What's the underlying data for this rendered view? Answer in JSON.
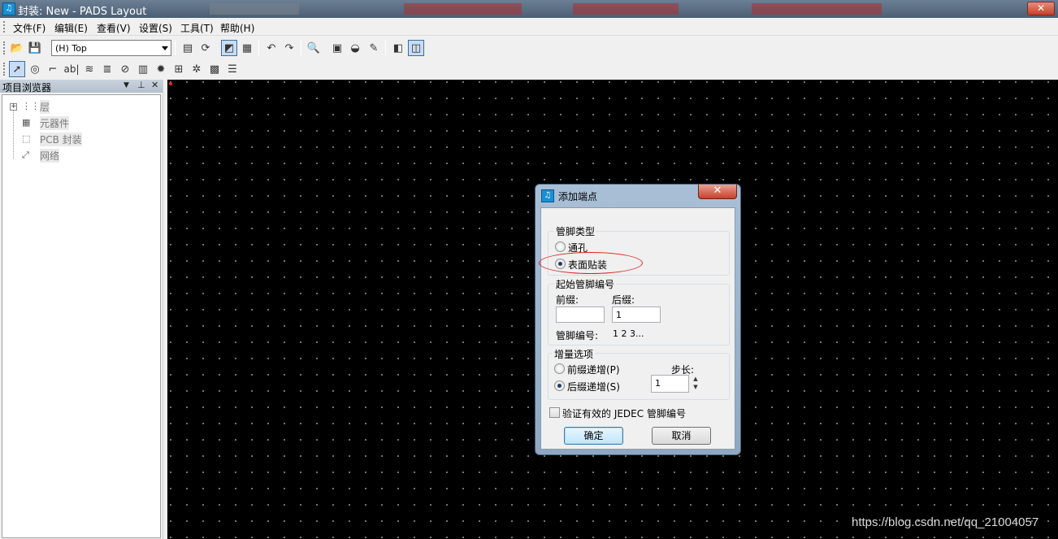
{
  "window": {
    "title": "封装: New - PADS Layout",
    "app_icon": "pads-icon",
    "close_label": "✕"
  },
  "menubar": {
    "items": [
      {
        "label": "文件(F)"
      },
      {
        "label": "编辑(E)"
      },
      {
        "label": "查看(V)"
      },
      {
        "label": "设置(S)"
      },
      {
        "label": "工具(T)"
      },
      {
        "label": "帮助(H)"
      }
    ]
  },
  "toolbar": {
    "layer_select": "(H) Top",
    "text_tool_label": "ab|"
  },
  "browser": {
    "title": "项目浏览器",
    "items": [
      {
        "label": "层",
        "expand": "+"
      },
      {
        "label": "元器件"
      },
      {
        "label": "PCB 封装"
      },
      {
        "label": "网络"
      }
    ]
  },
  "dialog": {
    "title": "添加端点",
    "close_label": "✕",
    "pin_type": {
      "group_label": "管脚类型",
      "options": [
        {
          "label": "通孔",
          "checked": false
        },
        {
          "label": "表面贴装",
          "checked": true
        }
      ]
    },
    "start_pin_number": {
      "group_label": "起始管脚编号",
      "prefix_label": "前缀:",
      "prefix_value": "",
      "suffix_label": "后缀:",
      "suffix_value": "1",
      "pin_number_label": "管脚编号:",
      "pin_number_preview": "1 2 3..."
    },
    "increment": {
      "group_label": "增量选项",
      "options": [
        {
          "label": "前缀递增(P)",
          "checked": false
        },
        {
          "label": "后缀递增(S)",
          "checked": true
        }
      ],
      "step_label": "步长:",
      "step_value": "1"
    },
    "jedec_checkbox": {
      "label": "验证有效的 JEDEC 管脚编号",
      "checked": false
    },
    "ok_label": "确定",
    "cancel_label": "取消"
  },
  "watermark": "https://blog.csdn.net/qq_21004057",
  "colors": {
    "canvas": "#000000",
    "grid_dot": "#8a8a8a",
    "highlight_ellipse": "#e02525"
  }
}
